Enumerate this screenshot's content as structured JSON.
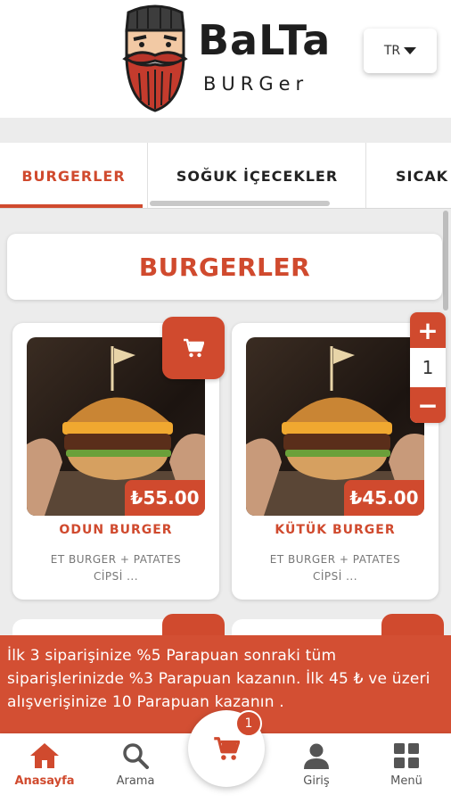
{
  "header": {
    "brand_name": "BaLTa",
    "brand_sub": "BURGer",
    "language": "TR"
  },
  "tabs": [
    {
      "label": "BURGERLER",
      "active": true
    },
    {
      "label": "SOĞUK İÇECEKLER",
      "active": false
    },
    {
      "label": "SICAK",
      "active": false
    }
  ],
  "section": {
    "title": "BURGERLER"
  },
  "products": [
    {
      "name": "ODUN BURGER",
      "price": "₺55.00",
      "description": "ET BURGER + PATATES CİPSİ ..."
    },
    {
      "name": "KÜTÜK BURGER",
      "price": "₺45.00",
      "description": "ET BURGER + PATATES CİPSİ ..."
    }
  ],
  "quantity": {
    "plus": "+",
    "value": "1",
    "minus": "−"
  },
  "promo": {
    "text": "İlk 3 siparişinize %5 Parapuan sonraki tüm siparişlerinizde %3 Parapuan kazanın. İlk 45 ₺ ve üzeri alışverişinize 10 Parapuan kazanın ."
  },
  "bottom_nav": {
    "home": "Anasayfa",
    "search": "Arama",
    "cart_count": "1",
    "login": "Giriş",
    "menu": "Menü"
  },
  "colors": {
    "accent": "#d04a2e",
    "promo_bg": "#d34f33",
    "background": "#ececec"
  },
  "icons": [
    "mascot-logo",
    "caret-down-icon",
    "cart-icon",
    "home-icon",
    "search-icon",
    "user-icon",
    "grid-menu-icon"
  ]
}
